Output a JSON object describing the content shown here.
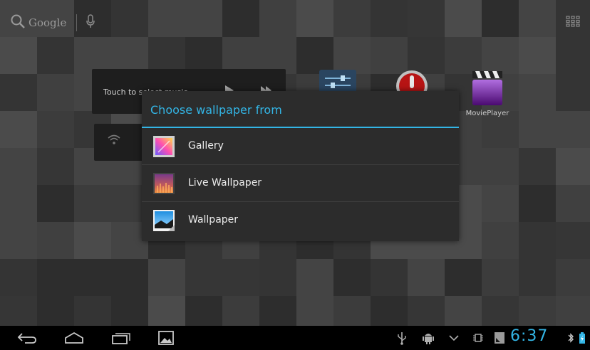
{
  "colors": {
    "accent": "#33b5e5",
    "dialog_bg": "#2c2c2c",
    "navbar_bg": "#000000"
  },
  "search": {
    "label": "Google",
    "icons": [
      "search-icon",
      "mic-icon"
    ]
  },
  "app_drawer_icon": "apps-grid-icon",
  "music_widget": {
    "text": "Touch to select music",
    "icons": [
      "play-icon",
      "next-icon"
    ]
  },
  "wifi_widget": {
    "icon": "wifi-icon"
  },
  "apps": [
    {
      "label": "",
      "icon": "settings-icon"
    },
    {
      "label": "",
      "icon": "voice-recorder-icon"
    },
    {
      "label": "MoviePlayer",
      "icon": "clapperboard-icon"
    }
  ],
  "dialog": {
    "title": "Choose wallpaper from",
    "options": [
      {
        "label": "Gallery",
        "icon": "gallery-icon"
      },
      {
        "label": "Live Wallpaper",
        "icon": "live-wallpaper-icon"
      },
      {
        "label": "Wallpaper",
        "icon": "wallpaper-icon"
      }
    ]
  },
  "navbar": {
    "buttons": [
      "back-icon",
      "home-icon",
      "recent-apps-icon",
      "screenshot-icon"
    ],
    "status_icons": [
      "usb-icon",
      "android-debug-icon",
      "chevron-down-icon",
      "chip-icon",
      "sdcard-icon"
    ],
    "time": "6:37",
    "tray_icons": [
      "bluetooth-icon",
      "battery-charging-icon"
    ]
  }
}
